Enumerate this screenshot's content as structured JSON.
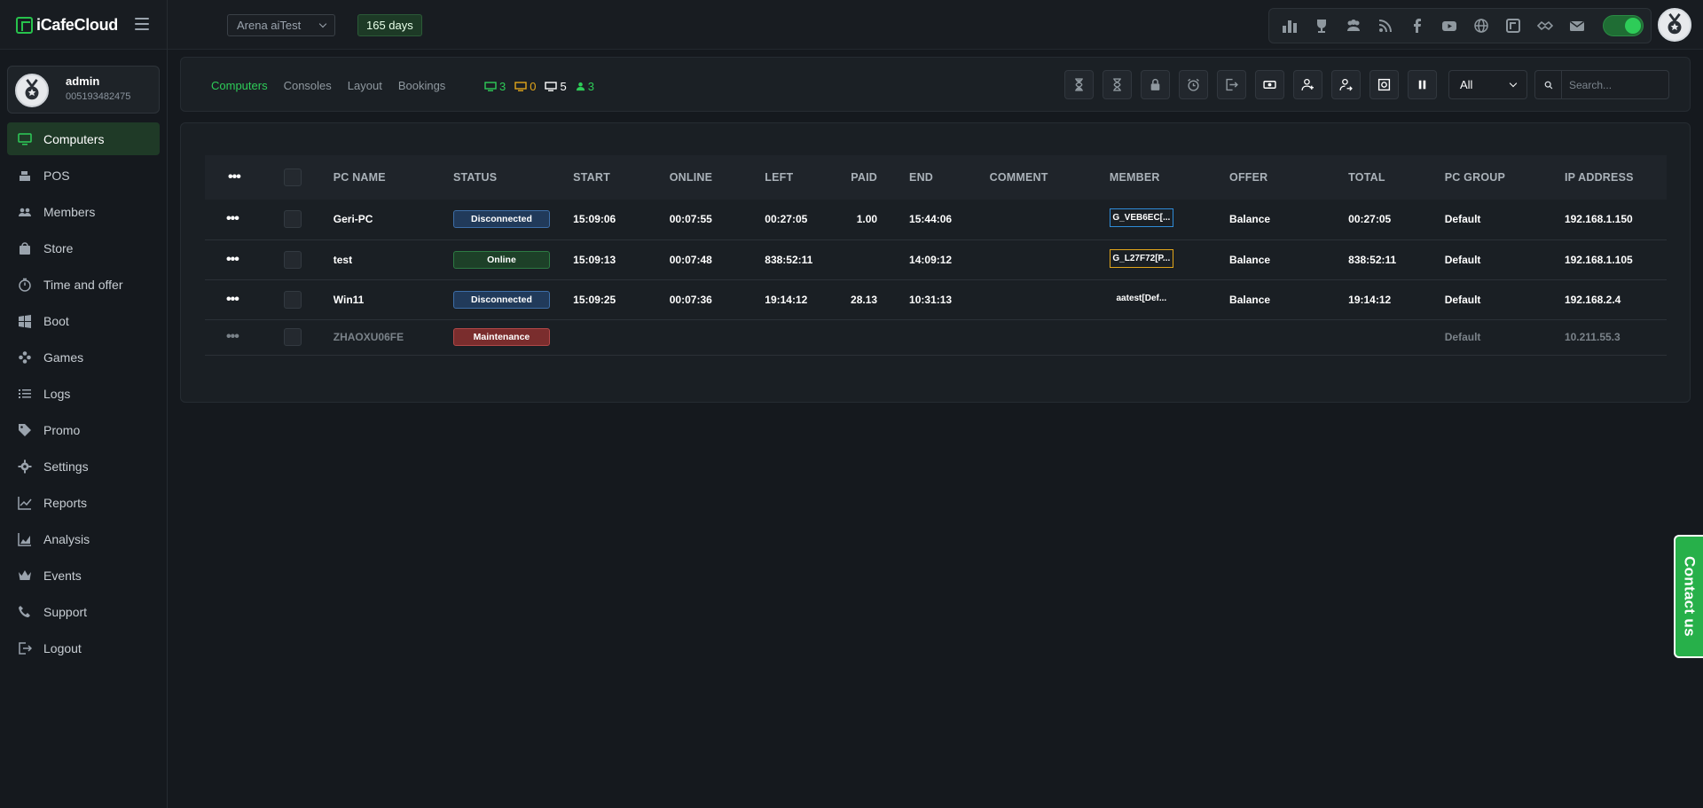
{
  "app": {
    "logo_text": "iCafeCloud"
  },
  "header": {
    "branch": "Arena aiTest",
    "days_left": "165 days",
    "icons": [
      "leaderboard-icon",
      "trophy-icon",
      "group-icon",
      "rss-icon",
      "facebook-icon",
      "youtube-icon",
      "globe-icon",
      "icafe-icon",
      "handshake-icon",
      "mail-icon"
    ]
  },
  "user": {
    "name": "admin",
    "id": "005193482475"
  },
  "sidebar": {
    "items": [
      {
        "label": "Computers",
        "icon": "monitor-icon",
        "active": true
      },
      {
        "label": "POS",
        "icon": "cash-register-icon"
      },
      {
        "label": "Members",
        "icon": "users-icon"
      },
      {
        "label": "Store",
        "icon": "bag-icon"
      },
      {
        "label": "Time and offer",
        "icon": "stopwatch-icon"
      },
      {
        "label": "Boot",
        "icon": "windows-icon"
      },
      {
        "label": "Games",
        "icon": "gamepad-icon"
      },
      {
        "label": "Logs",
        "icon": "list-icon"
      },
      {
        "label": "Promo",
        "icon": "tag-icon"
      },
      {
        "label": "Settings",
        "icon": "gear-icon"
      },
      {
        "label": "Reports",
        "icon": "line-chart-icon"
      },
      {
        "label": "Analysis",
        "icon": "area-chart-icon"
      },
      {
        "label": "Events",
        "icon": "crown-icon"
      },
      {
        "label": "Support",
        "icon": "phone-icon"
      },
      {
        "label": "Logout",
        "icon": "logout-icon"
      }
    ]
  },
  "toolbar": {
    "tabs": [
      "Computers",
      "Consoles",
      "Layout",
      "Bookings"
    ],
    "counts": {
      "online": "3",
      "warning": "0",
      "total": "5",
      "users": "3"
    },
    "filter": "All",
    "search_placeholder": "Search...",
    "tool_icons": [
      "hourglass-full-icon",
      "hourglass-empty-icon",
      "lock-icon",
      "alarm-icon",
      "exit-icon",
      "money-icon",
      "user-add-icon",
      "user-transfer-icon",
      "screenshot-icon",
      "pause-icon"
    ]
  },
  "table": {
    "headers": [
      "PC NAME",
      "STATUS",
      "START",
      "ONLINE",
      "LEFT",
      "PAID",
      "END",
      "COMMENT",
      "MEMBER",
      "OFFER",
      "TOTAL",
      "PC GROUP",
      "IP ADDRESS"
    ],
    "rows": [
      {
        "pc_name": "Geri-PC",
        "status": "Disconnected",
        "start": "15:09:06",
        "online": "00:07:55",
        "left": "00:27:05",
        "paid": "1.00",
        "end": "15:44:06",
        "comment": "",
        "member": "G_VEB6EC[...",
        "offer": "Balance",
        "total": "00:27:05",
        "pc_group": "Default",
        "ip": "192.168.1.150"
      },
      {
        "pc_name": "test",
        "status": "Online",
        "start": "15:09:13",
        "online": "00:07:48",
        "left": "838:52:11",
        "paid": "",
        "end": "14:09:12",
        "comment": "",
        "member": "G_L27F72[P...",
        "offer": "Balance",
        "total": "838:52:11",
        "pc_group": "Default",
        "ip": "192.168.1.105"
      },
      {
        "pc_name": "Win11",
        "status": "Disconnected",
        "start": "15:09:25",
        "online": "00:07:36",
        "left": "19:14:12",
        "paid": "28.13",
        "end": "10:31:13",
        "comment": "",
        "member": "aatest[Def...",
        "offer": "Balance",
        "total": "19:14:12",
        "pc_group": "Default",
        "ip": "192.168.2.4"
      },
      {
        "pc_name": "ZHAOXU06FE",
        "status": "Maintenance",
        "start": "",
        "online": "",
        "left": "",
        "paid": "",
        "end": "",
        "comment": "",
        "member": "",
        "offer": "",
        "total": "",
        "pc_group": "Default",
        "ip": "10.211.55.3"
      }
    ]
  },
  "contact_us": "Contact us",
  "colors": {
    "accent": "#2ecc58",
    "warning": "#e2a51a",
    "danger": "#b24848",
    "info": "#2f8cd8"
  }
}
